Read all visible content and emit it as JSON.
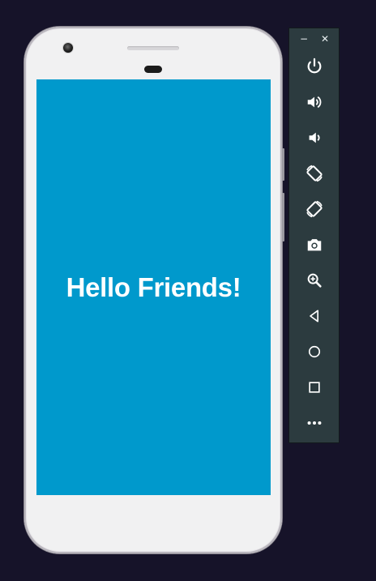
{
  "screen": {
    "message": "Hello Friends!",
    "background_color": "#0099cc",
    "text_color": "#ffffff"
  },
  "toolbar": {
    "background_color": "#2c3b3f",
    "icon_color": "#ffffff",
    "window_controls": {
      "minimize_label": "−",
      "close_label": "✕"
    },
    "buttons": [
      {
        "name": "power-icon"
      },
      {
        "name": "volume-up-icon"
      },
      {
        "name": "volume-down-icon"
      },
      {
        "name": "rotate-left-icon"
      },
      {
        "name": "rotate-right-icon"
      },
      {
        "name": "camera-icon"
      },
      {
        "name": "zoom-icon"
      },
      {
        "name": "back-icon"
      },
      {
        "name": "home-icon"
      },
      {
        "name": "overview-icon"
      },
      {
        "name": "more-icon"
      }
    ]
  }
}
